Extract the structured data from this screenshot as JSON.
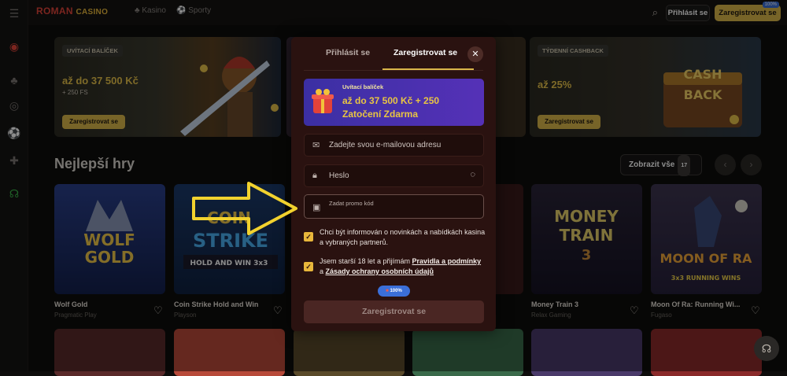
{
  "header": {
    "logo_roman": "ROMAN",
    "logo_casino": "CASINO",
    "nav": [
      {
        "label": "Kasino",
        "icon": "club-icon"
      },
      {
        "label": "Sporty",
        "icon": "soccer-icon"
      }
    ],
    "login_label": "Přihlásit se",
    "register_label": "Zaregistrovat se",
    "register_badge": "100%"
  },
  "banners": [
    {
      "tag": "UVÍTACÍ BALÍČEK",
      "title": "až do 37 500 Kč",
      "sub": "+ 250 FS",
      "button": "Zaregistrovat se"
    },
    {
      "tag": "TÝDENNÍ CASHBACK",
      "title": "až 25%",
      "sub": "",
      "button": "Zaregistrovat se",
      "art_text": "CASH BACK"
    }
  ],
  "section": {
    "title": "Nejlepší hry",
    "show_all": "Zobrazit vše",
    "count": "17"
  },
  "games": [
    {
      "name": "Wolf Gold",
      "provider": "Pragmatic Play",
      "art": "WOLF GOLD"
    },
    {
      "name": "Coin Strike Hold and Win",
      "provider": "Playson",
      "art": "COIN STRIKE",
      "art2": "HOLD AND WIN 3x3"
    },
    {
      "name": "Money Train 3",
      "provider": "Relax Gaming",
      "art": "MONEY TRAIN 3"
    },
    {
      "name": "Moon Of Ra: Running Wi...",
      "provider": "Fugaso",
      "art": "MOON OF RA",
      "art2": "3x3 RUNNING WINS"
    }
  ],
  "modal": {
    "tab_login": "Přihlásit se",
    "tab_register": "Zaregistrovat se",
    "promo_label": "Uvítací balíček",
    "promo_text": "až do 37 500 Kč + 250 Zatočení Zdarma",
    "email_placeholder": "Zadejte svou e-mailovou adresu",
    "password_placeholder": "Heslo",
    "promo_code_placeholder": "Zadat promo kód",
    "check1": "Chci být informován o novinkách a nabídkách kasina a vybraných partnerů.",
    "check2_pre": "Jsem starší 18 let a přijímám ",
    "check2_link1": "Pravidla a podmínky",
    "check2_mid": " a ",
    "check2_link2": "Zásady ochrany osobních údajů",
    "badge": "100%",
    "submit": "Zaregistrovat se"
  },
  "colors": {
    "accent": "#d9b64a",
    "modal_bg": "#2a1210",
    "annotation_arrow": "#f2d22e"
  }
}
